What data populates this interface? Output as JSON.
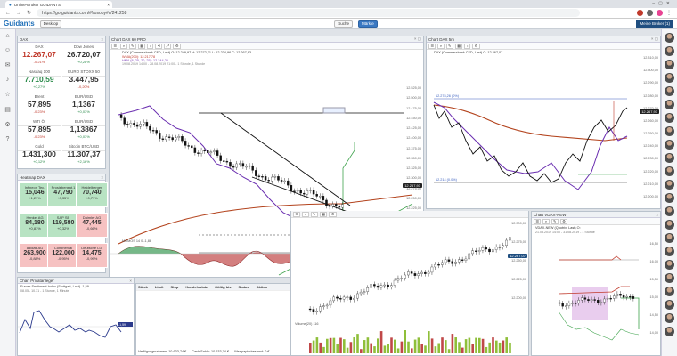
{
  "browser": {
    "tab_title": "Online-Broker GUIDANTS",
    "url": "https://go.guidants.com/#!/osopy#c/241258"
  },
  "app": {
    "logo": "Guidants",
    "desktop_btn": "Desktop",
    "search_btn": "Suche",
    "markets_btn": "Märkte",
    "max_btn": "Meine Broker (1)"
  },
  "quotes": {
    "title": "DAX",
    "items": [
      {
        "name": "DAX",
        "value": "12.267,07",
        "change": "-0,21%",
        "dir": "neg"
      },
      {
        "name": "Dow Jones",
        "value": "26.720,07",
        "change": "+0,28%",
        "dir": "pos"
      },
      {
        "name": "Nasdaq 100",
        "value": "7.710,59",
        "change": "+0,27%",
        "dir": "pos"
      },
      {
        "name": "EURO STOXX 50",
        "value": "3.447,95",
        "change": "-0,20%",
        "dir": "neg"
      },
      {
        "name": "Brent",
        "value": "57,895",
        "change": "-0,23%",
        "dir": "neg"
      },
      {
        "name": "EUR/USD",
        "value": "1,1367",
        "change": "+0,03%",
        "dir": "pos"
      },
      {
        "name": "WTI Öl",
        "value": "57,895",
        "change": "-0,23%",
        "dir": "neg"
      },
      {
        "name": "EUR/USD",
        "value": "1,13867",
        "change": "+0,03%",
        "dir": "pos"
      },
      {
        "name": "Gold",
        "value": "1.431,300",
        "change": "+0,12%",
        "dir": "pos"
      },
      {
        "name": "Bitcoin BTC/USD",
        "value": "11.307,37",
        "change": "+2,16%",
        "dir": "pos"
      }
    ]
  },
  "heatmap": {
    "title": "Heatmap DAX",
    "cells": [
      {
        "name": "Infineon Tec.",
        "value": "15,046",
        "change": "+1,21%",
        "dir": "pos"
      },
      {
        "name": "Prosiebensat.1",
        "value": "47,790",
        "change": "+0,35%",
        "dir": "pos"
      },
      {
        "name": "Heidelberger",
        "value": "70,740",
        "change": "+0,71%",
        "dir": "pos"
      },
      {
        "name": "Henkel AG",
        "value": "84,180",
        "change": "+0,81%",
        "dir": "pos"
      },
      {
        "name": "SAP SE",
        "value": "119,580",
        "change": "+0,32%",
        "dir": "pos"
      },
      {
        "name": "Daimler AG",
        "value": "47,445",
        "change": "-0,66%",
        "dir": "neg"
      },
      {
        "name": "adidas AG",
        "value": "263,900",
        "change": "-0,88%",
        "dir": "neg"
      },
      {
        "name": "Continental",
        "value": "122,000",
        "change": "-0,95%",
        "dir": "neg"
      },
      {
        "name": "Deutsche Lu.",
        "value": "14,475",
        "change": "-0,99%",
        "dir": "neg"
      }
    ]
  },
  "main_chart": {
    "title": "Chart DAX 60 PRO",
    "legend1": "DAX (Commerzbank CFD, Last) O: 12.249,97 H: 12.272,71 L: 12.234,96 C: 12.267,93",
    "legend2": "WMA(200): 12.217,78",
    "legend3": "HMA (8, 25, 20, 25): 12.244,20",
    "range": "19.08.2019 14:00 - 28.08.2019 21:00 - 1 Stunde, 1 Stunde",
    "prices": [
      "12.525,00",
      "12.500,00",
      "12.475,00",
      "12.450,00",
      "12.425,00",
      "12.400,00",
      "12.375,00",
      "12.350,00",
      "12.325,00",
      "12.300,00",
      "12.275,00",
      "12.250,00",
      "12.225,00",
      "12.200,00",
      "12.175,00",
      "12.150,00"
    ],
    "last": "12.267,93",
    "osc": "MOMOS 14 0 -1,88"
  },
  "right_chart": {
    "title": "Chart DAX 5m",
    "legend": "DAX (Commerzbank CFD, Last) O: 12.267,07",
    "level1": "12.278,26 (0%)",
    "level2": "12.214 (0.0%)",
    "last": "12.267,93",
    "prices": [
      "12.310,00",
      "12.300,00",
      "12.290,00",
      "12.280,00",
      "12.270,00",
      "12.260,00",
      "12.250,00",
      "12.240,00",
      "12.230,00",
      "12.220,00",
      "12.210,00",
      "12.200,00"
    ]
  },
  "mid_chart": {
    "last": "12.267,07",
    "prices": [
      "12.300,00",
      "12.275,00",
      "12.250,00",
      "12.225,00",
      "12.200,00"
    ]
  },
  "small_chart": {
    "title": "Chart VDAX-NEW",
    "legend": "VDAX-NEW (Quotrix, Last) O:",
    "range": "21.08.2019 14:00 - 31.08.2019 - 1 Stunde",
    "prices": [
      "16,50",
      "16,00",
      "15,50",
      "15,00",
      "14,50",
      "14,00"
    ],
    "last": "16,53"
  },
  "sentiment": {
    "title": "Chart Privatanleger",
    "legend": "Euwax Sentiment Index (Stuttgart, Last) -1,59",
    "range": "08.05 - 10.31 - 1 Stunde, 1 Minute",
    "last": "-1,59"
  },
  "orders": {
    "cols": [
      "Stück",
      "Limit",
      "Stop",
      "Handelsplatz",
      "Gültig bis",
      "Status",
      "Aktion"
    ],
    "footer": [
      "Verfügungsrahmen: 10.633,74 €",
      "Cash Saldo: 10.633,74 €",
      "Wertpapierbestand: 0 €"
    ]
  },
  "volume": {
    "label": "Volume(20) 116",
    "axis": [
      "10:00",
      "12:00",
      "14:00"
    ]
  }
}
